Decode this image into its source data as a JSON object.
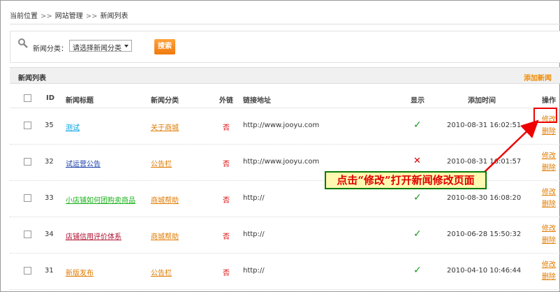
{
  "breadcrumb": {
    "current": "当前位置",
    "section": "网站管理",
    "page": "新闻列表",
    "separator": ">>"
  },
  "filter": {
    "label": "新闻分类：",
    "select_value": "请选择新闻分类",
    "search_button": "搜索"
  },
  "table": {
    "title": "新闻列表",
    "add_link": "添加新闻",
    "columns": [
      "ID",
      "新闻标题",
      "新闻分类",
      "外链",
      "链接地址",
      "显示",
      "添加时间",
      "操作"
    ],
    "rows": [
      {
        "id": "35",
        "title": "测试",
        "title_color": "#00a0e0",
        "category": "关于商城",
        "external": "否",
        "url": "http://www.jooyu.com",
        "shown": "✓",
        "time": "2010-08-31 16:02:51",
        "edit": "修改",
        "delete": "删除"
      },
      {
        "id": "32",
        "title": "试运营公告",
        "title_color": "#1a3fa8",
        "category": "公告栏",
        "external": "否",
        "url": "http://www.jooyu.com",
        "shown": "✕",
        "time": "2010-08-31 16:01:57",
        "edit": "修改",
        "delete": "删除"
      },
      {
        "id": "33",
        "title": "小店铺如何团购卖商品",
        "title_color": "#18b018",
        "category": "商城帮助",
        "external": "否",
        "url": "http://",
        "shown": "✓",
        "time": "2010-08-30 16:08:20",
        "edit": "修改",
        "delete": "删除"
      },
      {
        "id": "34",
        "title": "店铺信用评价体系",
        "title_color": "#b01030",
        "category": "商城帮助",
        "external": "否",
        "url": "http://",
        "shown": "✓",
        "time": "2010-06-28 15:50:32",
        "edit": "修改",
        "delete": "删除"
      },
      {
        "id": "31",
        "title": "新版发布",
        "title_color": "#e07b00",
        "category": "公告栏",
        "external": "否",
        "url": "http://",
        "shown": "✓",
        "time": "2010-04-10 10:46:44",
        "edit": "修改",
        "delete": "删除"
      }
    ]
  },
  "annotation": {
    "text": "点击“修改”打开新闻修改页面"
  },
  "colors": {
    "accent": "#f08a00",
    "link_orange": "#e07b00",
    "danger": "#dd0000",
    "ok": "#1a9a1a",
    "callout_bg": "#fff8b0",
    "callout_border": "#0a7a0a"
  }
}
